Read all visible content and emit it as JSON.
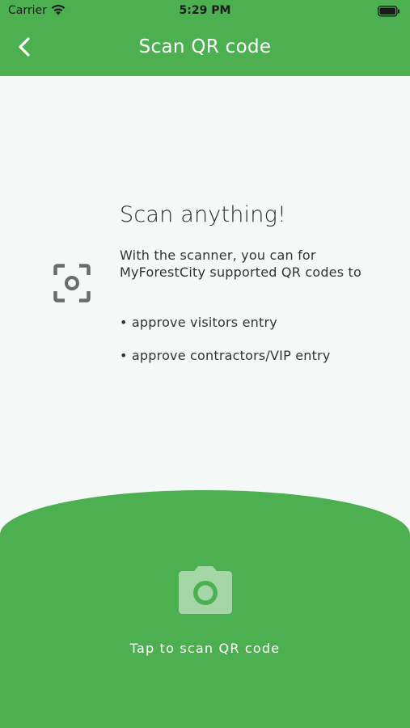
{
  "status_bar": {
    "carrier": "Carrier",
    "time": "5:29 PM"
  },
  "header": {
    "title": "Scan QR code",
    "back_icon": "chevron-left-icon"
  },
  "main": {
    "icon": "scan-focus-icon",
    "headline": "Scan anything!",
    "description": "With the scanner, you can for MyForestCity supported QR codes to",
    "bullets": [
      "• approve visitors entry",
      "• approve contractors/VIP entry"
    ]
  },
  "bottom": {
    "camera_icon": "camera-icon",
    "tap_label": "Tap to scan QR code"
  },
  "colors": {
    "brand_green": "#4caf50",
    "background": "#f4f8f6",
    "camera_icon_fill": "#a5d6a7"
  }
}
